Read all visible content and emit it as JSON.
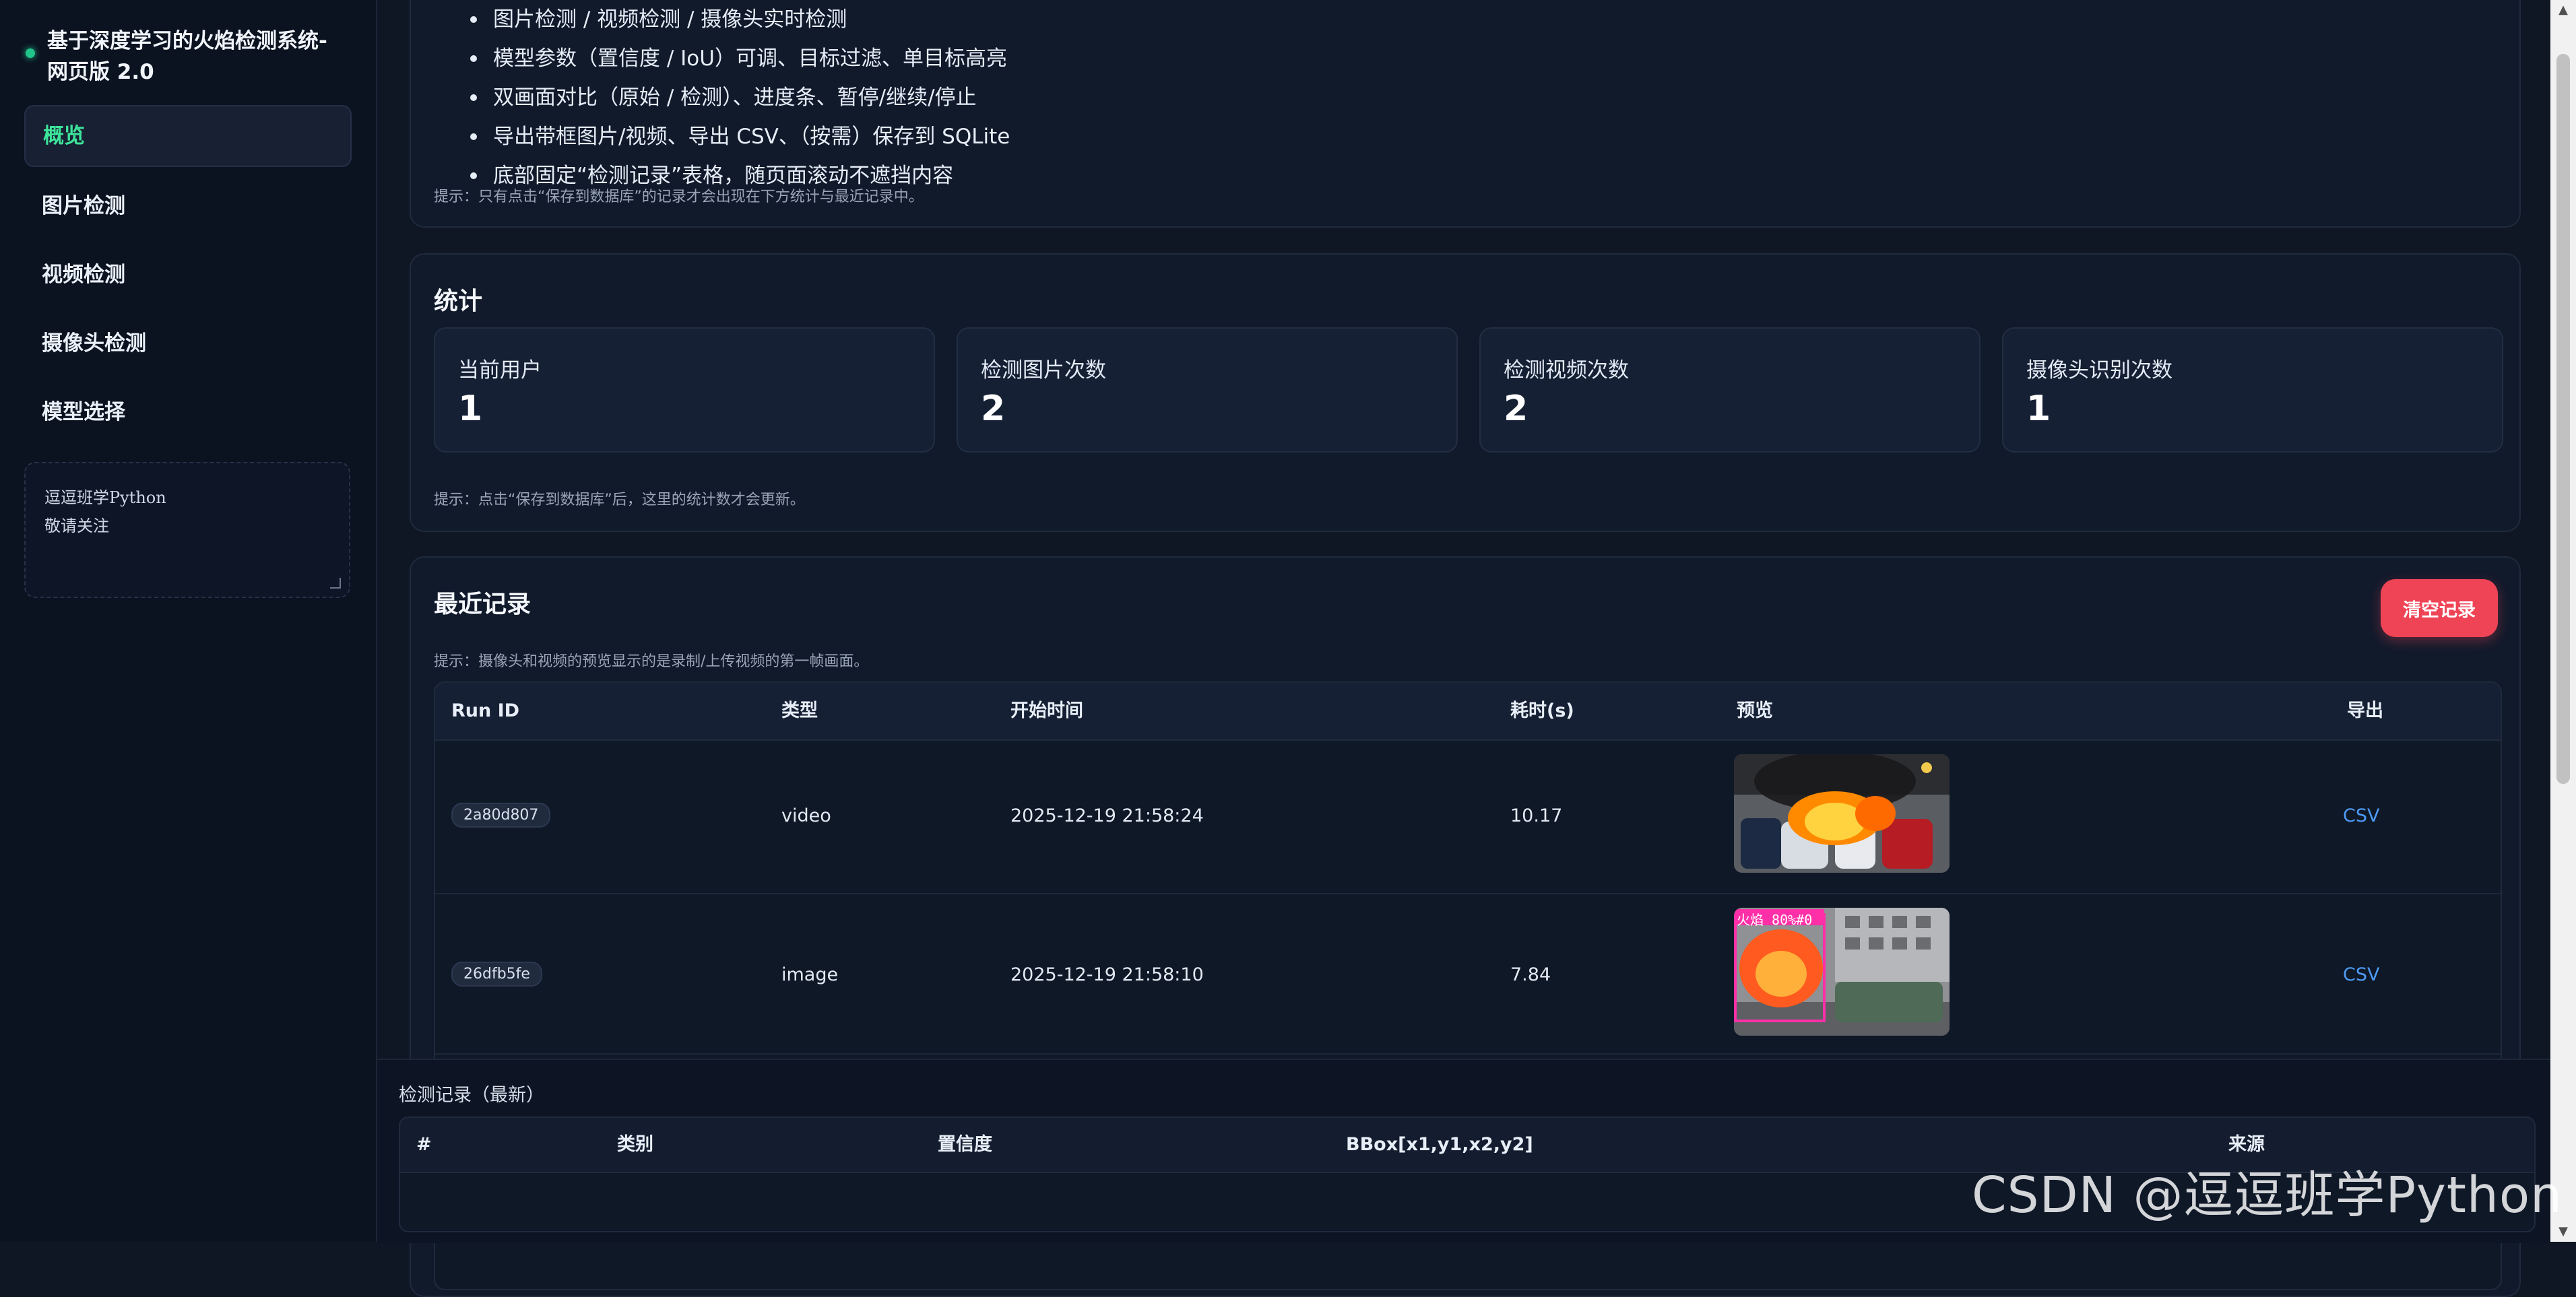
{
  "sidebar": {
    "title": "基于深度学习的火焰检测系统-网页版 2.0",
    "items": [
      {
        "label": "概览"
      },
      {
        "label": "图片检测"
      },
      {
        "label": "视频检测"
      },
      {
        "label": "摄像头检测"
      },
      {
        "label": "模型选择"
      }
    ],
    "note_line1": "逗逗班学Python",
    "note_line2": "敬请关注"
  },
  "features": {
    "items": [
      "图片检测 / 视频检测 / 摄像头实时检测",
      "模型参数（置信度 / IoU）可调、目标过滤、单目标高亮",
      "双画面对比（原始 / 检测）、进度条、暂停/继续/停止",
      "导出带框图片/视频、导出 CSV、（按需）保存到 SQLite",
      "底部固定“检测记录”表格，随页面滚动不遮挡内容"
    ],
    "hint": "提示：只有点击“保存到数据库”的记录才会出现在下方统计与最近记录中。"
  },
  "stats": {
    "title": "统计",
    "boxes": [
      {
        "label": "当前用户",
        "value": "1"
      },
      {
        "label": "检测图片次数",
        "value": "2"
      },
      {
        "label": "检测视频次数",
        "value": "2"
      },
      {
        "label": "摄像头识别次数",
        "value": "1"
      }
    ],
    "hint": "提示：点击“保存到数据库”后，这里的统计数才会更新。"
  },
  "recent": {
    "title": "最近记录",
    "clear_label": "清空记录",
    "hint": "提示：摄像头和视频的预览显示的是录制/上传视频的第一帧画面。",
    "columns": [
      "Run ID",
      "类型",
      "开始时间",
      "耗时(s)",
      "预览",
      "导出"
    ],
    "rows": [
      {
        "run_id": "2a80d807",
        "type": "video",
        "start": "2025-12-19 21:58:24",
        "duration": "10.17",
        "export": "CSV"
      },
      {
        "run_id": "26dfb5fe",
        "type": "image",
        "start": "2025-12-19 21:58:10",
        "duration": "7.84",
        "export": "CSV",
        "overlay": "火焰 80%#0"
      }
    ]
  },
  "bottom": {
    "title": "检测记录（最新）",
    "columns": [
      "#",
      "类别",
      "置信度",
      "BBox[x1,y1,x2,y2]",
      "来源"
    ]
  },
  "watermark": "CSDN @逗逗班学Python",
  "colors": {
    "accent": "#3ee39a",
    "danger": "#ef4456",
    "link": "#4d9cf6"
  }
}
